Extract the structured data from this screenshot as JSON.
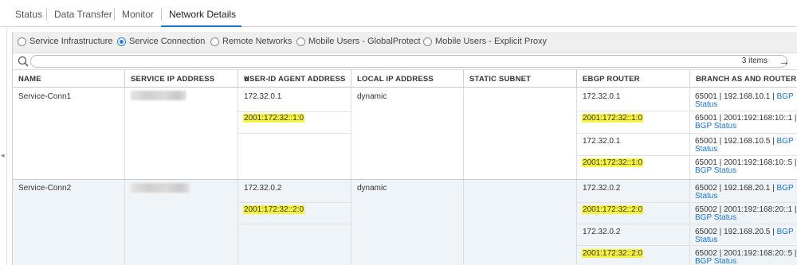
{
  "tabs": [
    {
      "label": "Status"
    },
    {
      "label": "Data Transfer"
    },
    {
      "label": "Monitor"
    },
    {
      "label": "Network Details"
    }
  ],
  "radios": [
    {
      "label": "Service Infrastructure",
      "selected": false
    },
    {
      "label": "Service Connection",
      "selected": true
    },
    {
      "label": "Remote Networks",
      "selected": false
    },
    {
      "label": "Mobile Users - GlobalProtect",
      "selected": false
    },
    {
      "label": "Mobile Users - Explicit Proxy",
      "selected": false
    }
  ],
  "search": {
    "placeholder": "",
    "count": "3 items"
  },
  "columns": [
    "NAME",
    "SERVICE IP ADDRESS",
    "USER-ID AGENT ADDRESS",
    "LOCAL IP ADDRESS",
    "STATIC SUBNET",
    "EBGP ROUTER",
    "BRANCH AS AND ROUTER"
  ],
  "rows": [
    {
      "name": "Service-Conn1",
      "service_ip": "",
      "local_ip": "dynamic",
      "userid": [
        "172.32.0.1",
        "2001:172:32::1:0"
      ],
      "ebgp": [
        "172.32.0.1",
        "2001:172:32::1:0",
        "172.32.0.1",
        "2001:172:32::1:0"
      ],
      "branch": [
        {
          "a": "65001 | 192.168.10.1 |",
          "b": "BGP",
          "c": "Status"
        },
        {
          "a": "65001 | 2001:192:168:10::1 |",
          "b": "",
          "c": "BGP Status"
        },
        {
          "a": "65001 | 192.168.10.5 |",
          "b": "BGP",
          "c": "Status"
        },
        {
          "a": "65001 | 2001:192:168:10::5 |",
          "b": "",
          "c": "BGP Status"
        }
      ]
    },
    {
      "name": "Service-Conn2",
      "service_ip": "",
      "local_ip": "dynamic",
      "userid": [
        "172.32.0.2",
        "2001:172:32::2:0"
      ],
      "ebgp": [
        "172.32.0.2",
        "2001:172:32::2:0",
        "172.32.0.2",
        "2001:172:32::2:0"
      ],
      "branch": [
        {
          "a": "65002 | 192.168.20.1 |",
          "b": "BGP",
          "c": "Status"
        },
        {
          "a": "65002 | 2001:192:168:20::1 |",
          "b": "",
          "c": "BGP Status"
        },
        {
          "a": "65002 | 192.168.20.5 |",
          "b": "BGP",
          "c": "Status"
        },
        {
          "a": "65002 | 2001:192:168:20::5 |",
          "b": "",
          "c": "BGP Status"
        }
      ]
    }
  ],
  "colors": {
    "accent": "#1a73c8",
    "highlight": "#f7f342",
    "row_alt": "#eef4f8"
  }
}
